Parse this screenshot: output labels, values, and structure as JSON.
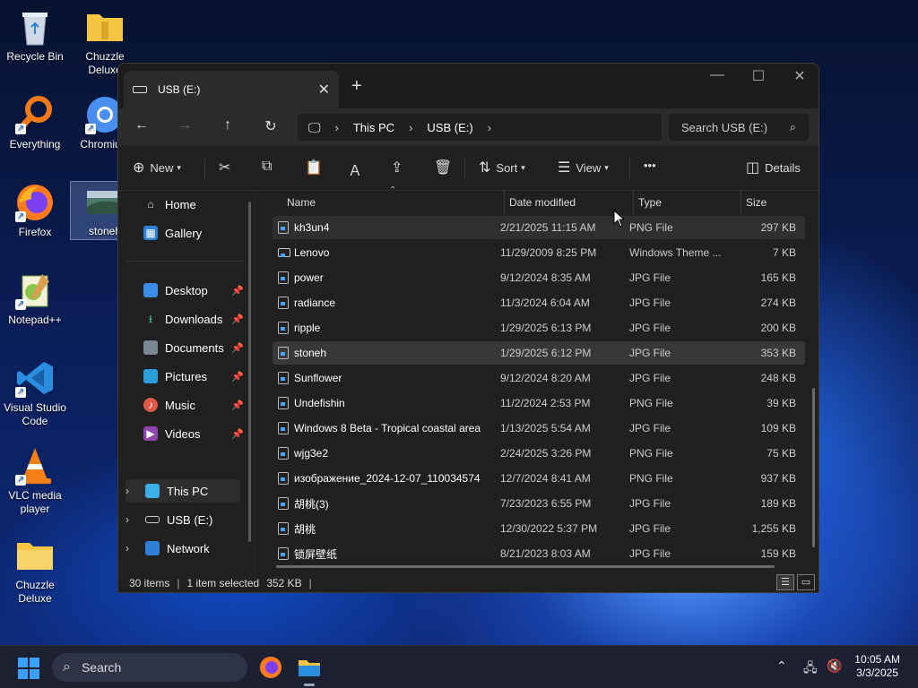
{
  "desktop": {
    "icons": [
      {
        "label": "Recycle Bin"
      },
      {
        "label": "Chuzzle Deluxe"
      },
      {
        "label": "Everything"
      },
      {
        "label": "Chromium"
      },
      {
        "label": "Firefox"
      },
      {
        "label": "stoneh"
      },
      {
        "label": "Notepad++"
      },
      {
        "label": "Visual Studio Code"
      },
      {
        "label": "VLC media player"
      },
      {
        "label": "Chuzzle Deluxe"
      }
    ]
  },
  "window": {
    "tab_title": "USB (E:)",
    "new_tab": "+",
    "address": {
      "root": "This PC",
      "drive": "USB (E:)"
    },
    "search_placeholder": "Search USB (E:)",
    "toolbar": {
      "new_label": "New",
      "sort_label": "Sort",
      "view_label": "View",
      "more_label": "•••",
      "details_label": "Details"
    },
    "sidebar": {
      "quick": [
        {
          "label": "Home"
        },
        {
          "label": "Gallery"
        }
      ],
      "pinned": [
        {
          "label": "Desktop"
        },
        {
          "label": "Downloads"
        },
        {
          "label": "Documents"
        },
        {
          "label": "Pictures"
        },
        {
          "label": "Music"
        },
        {
          "label": "Videos"
        }
      ],
      "tree": [
        {
          "label": "This PC"
        },
        {
          "label": "USB (E:)"
        },
        {
          "label": "Network"
        }
      ]
    },
    "columns": {
      "name": "Name",
      "date": "Date modified",
      "type": "Type",
      "size": "Size"
    },
    "files": [
      {
        "name": "kh3un4",
        "date": "2/21/2025 11:15 AM",
        "type": "PNG File",
        "size": "297 KB"
      },
      {
        "name": "Lenovo",
        "date": "11/29/2009 8:25 PM",
        "type": "Windows Theme ...",
        "size": "7 KB"
      },
      {
        "name": "power",
        "date": "9/12/2024 8:35 AM",
        "type": "JPG File",
        "size": "165 KB"
      },
      {
        "name": "radiance",
        "date": "11/3/2024 6:04 AM",
        "type": "JPG File",
        "size": "274 KB"
      },
      {
        "name": "ripple",
        "date": "1/29/2025 6:13 PM",
        "type": "JPG File",
        "size": "200 KB"
      },
      {
        "name": "stoneh",
        "date": "1/29/2025 6:12 PM",
        "type": "JPG File",
        "size": "353 KB"
      },
      {
        "name": "Sunflower",
        "date": "9/12/2024 8:20 AM",
        "type": "JPG File",
        "size": "248 KB"
      },
      {
        "name": "Undefishin",
        "date": "11/2/2024 2:53 PM",
        "type": "PNG File",
        "size": "39 KB"
      },
      {
        "name": "Windows 8 Beta - Tropical coastal area",
        "date": "1/13/2025 5:54 AM",
        "type": "JPG File",
        "size": "109 KB"
      },
      {
        "name": "wjg3e2",
        "date": "2/24/2025 3:26 PM",
        "type": "PNG File",
        "size": "75 KB"
      },
      {
        "name": "изображение_2024-12-07_110034574",
        "date": "12/7/2024 8:41 AM",
        "type": "PNG File",
        "size": "937 KB"
      },
      {
        "name": "胡桃(3)",
        "date": "7/23/2023 6:55 PM",
        "type": "JPG File",
        "size": "189 KB"
      },
      {
        "name": "胡桃",
        "date": "12/30/2022 5:37 PM",
        "type": "JPG File",
        "size": "1,255 KB"
      },
      {
        "name": "锁屏壁纸",
        "date": "8/21/2023 8:03 AM",
        "type": "JPG File",
        "size": "159 KB"
      }
    ],
    "status": {
      "items": "30 items",
      "selected": "1 item selected",
      "size": "352 KB"
    }
  },
  "taskbar": {
    "search_label": "Search",
    "time": "10:05 AM",
    "date": "3/3/2025"
  },
  "colors": {
    "accent": "#3aa0ff",
    "window_bg": "#202020",
    "selected_row": "#383838"
  }
}
